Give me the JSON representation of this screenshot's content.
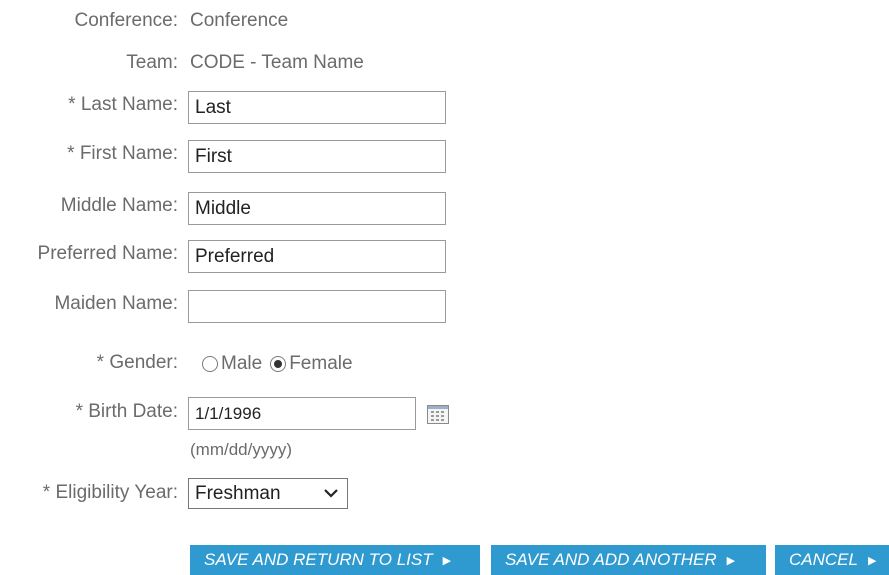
{
  "form": {
    "conference": {
      "label": "Conference:",
      "value": "Conference"
    },
    "team": {
      "label": "Team:",
      "value": "CODE - Team Name"
    },
    "last_name": {
      "label": "* Last Name:",
      "value": "Last"
    },
    "first_name": {
      "label": "* First Name:",
      "value": "First"
    },
    "middle_name": {
      "label": "Middle Name:",
      "value": "Middle"
    },
    "preferred_name": {
      "label": "Preferred Name:",
      "value": "Preferred"
    },
    "maiden_name": {
      "label": "Maiden Name:",
      "value": ""
    },
    "gender": {
      "label": "* Gender:",
      "options": [
        "Male",
        "Female"
      ],
      "selected": "Female"
    },
    "birth_date": {
      "label": "* Birth Date:",
      "value": "1/1/1996",
      "hint": "(mm/dd/yyyy)"
    },
    "eligibility_year": {
      "label": "* Eligibility Year:",
      "value": "Freshman"
    }
  },
  "buttons": {
    "save_return": "SAVE AND RETURN TO LIST",
    "save_add": "SAVE AND ADD ANOTHER",
    "cancel": "CANCEL"
  },
  "colors": {
    "button_bg": "#2f9ad0",
    "label_text": "#6b6b6b"
  },
  "icons": {
    "calendar": "calendar-icon",
    "dropdown": "chevron-down-icon",
    "button_arrow": "arrow-right-icon"
  }
}
